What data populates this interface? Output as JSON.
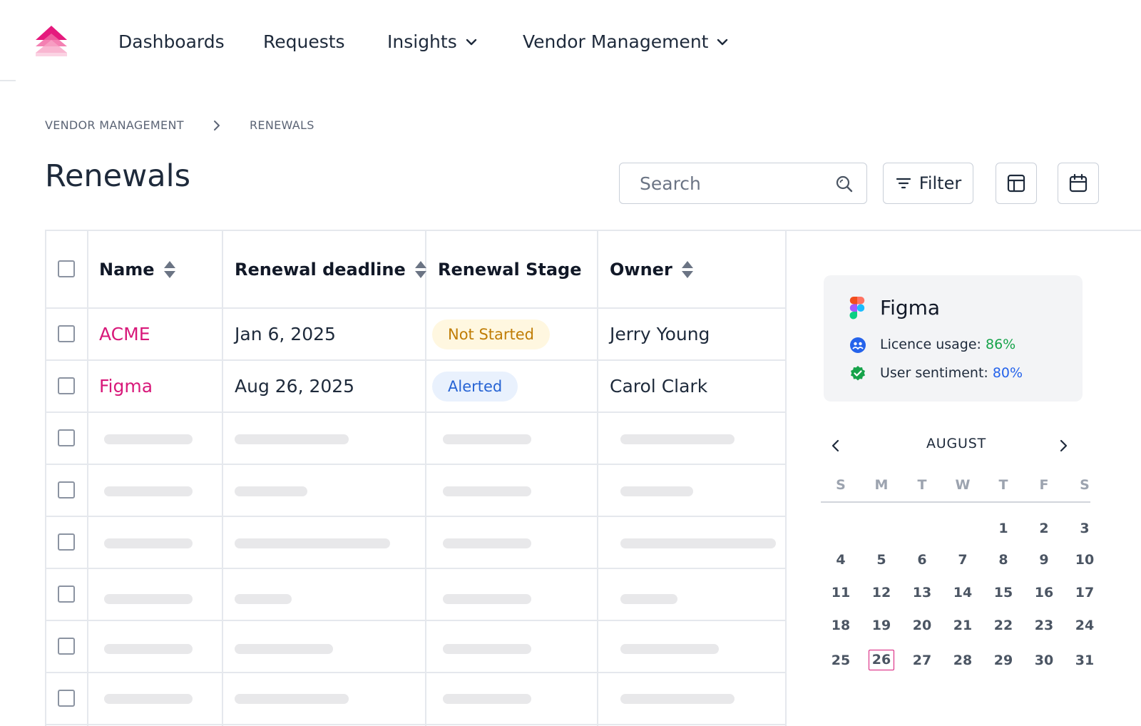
{
  "nav": {
    "items": [
      {
        "label": "Dashboards"
      },
      {
        "label": "Requests"
      },
      {
        "label": "Insights"
      },
      {
        "label": "Vendor Management"
      }
    ]
  },
  "breadcrumb": [
    "VENDOR MANAGEMENT",
    "RENEWALS"
  ],
  "page_title": "Renewals",
  "toolbar": {
    "search_placeholder": "Search",
    "filter_label": "Filter"
  },
  "table": {
    "columns": [
      "Name",
      "Renewal deadline",
      "Renewal Stage",
      "Owner"
    ],
    "rows": [
      {
        "name": "ACME",
        "deadline": "Jan 6, 2025",
        "stage": "Not Started",
        "owner": "Jerry Young"
      },
      {
        "name": "Figma",
        "deadline": "Aug 26, 2025",
        "stage": "Alerted",
        "owner": "Carol Clark"
      }
    ]
  },
  "vendor_card": {
    "title": "Figma",
    "licence_label": "Licence usage:",
    "licence_value": "86%",
    "sentiment_label": "User sentiment:",
    "sentiment_value": "80%"
  },
  "calendar": {
    "month": "AUGUST",
    "weekdays": [
      "S",
      "M",
      "T",
      "W",
      "T",
      "F",
      "S"
    ],
    "weeks": [
      [
        "",
        "",
        "",
        "",
        "1",
        "2",
        "3"
      ],
      [
        "4",
        "5",
        "6",
        "7",
        "8",
        "9",
        "10"
      ],
      [
        "11",
        "12",
        "13",
        "14",
        "15",
        "16",
        "17"
      ],
      [
        "18",
        "19",
        "20",
        "21",
        "22",
        "23",
        "24"
      ],
      [
        "25",
        "26",
        "27",
        "28",
        "29",
        "30",
        "31"
      ]
    ],
    "selected": "26"
  },
  "colors": {
    "accent": "#d8197a",
    "not_started_bg": "#fff7e0",
    "not_started_text": "#c07d06",
    "alerted_bg": "#e9f1fd",
    "alerted_text": "#2663d4",
    "positive": "#16a34a",
    "link_blue": "#2563eb"
  },
  "icons": [
    "brand-logo",
    "chevron-down-icon",
    "chevron-right-icon",
    "search-icon",
    "filter-icon",
    "table-view-icon",
    "calendar-icon",
    "sort-icon",
    "figma-logo",
    "users-icon",
    "verified-icon",
    "chevron-left-icon"
  ]
}
